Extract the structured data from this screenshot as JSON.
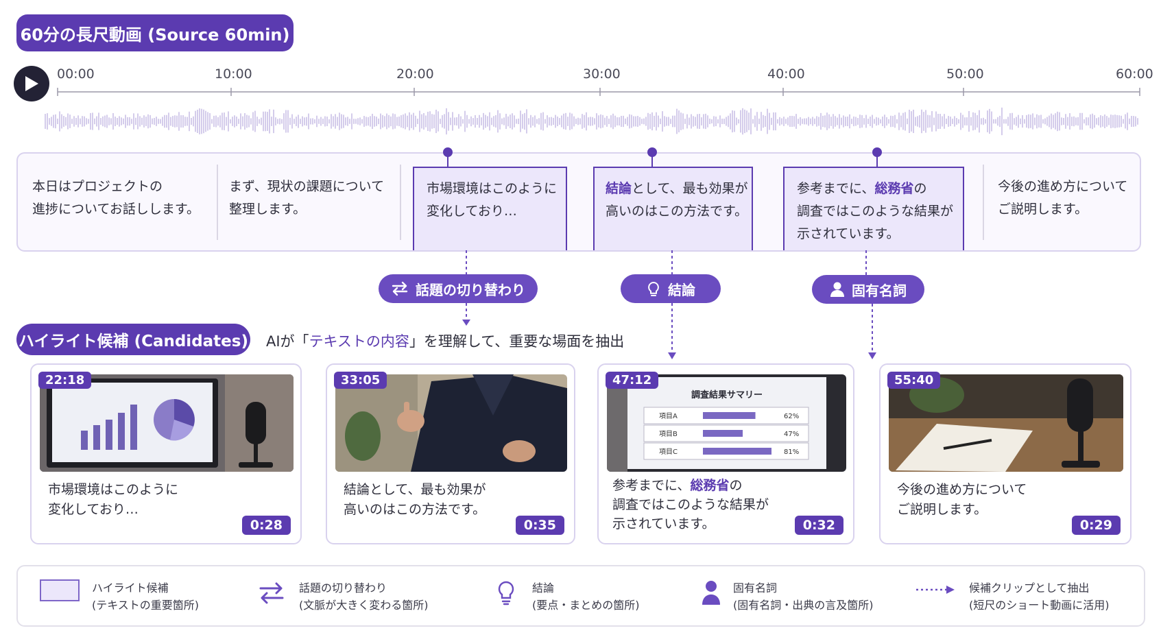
{
  "source_title": "60分の長尺動画 (Source 60min)",
  "timeline": {
    "ticks": [
      "00:00",
      "10:00",
      "20:00",
      "30:00",
      "40:00",
      "50:00",
      "60:00"
    ]
  },
  "transcript": {
    "segments": [
      {
        "line1": "本日はプロジェクトの",
        "line2": "進捗についてお話しします。",
        "line3": ""
      },
      {
        "line1": "まず、現状の課題について",
        "line2": "整理します。",
        "line3": ""
      },
      {
        "line1": "市場環境はこのように",
        "line2": "変化しており…",
        "line3": ""
      },
      {
        "line1_accent": "結論",
        "line1_rest": "として、最も効果が",
        "line2": "高いのはこの方法です。",
        "line3": ""
      },
      {
        "line1_pre": "参考までに、",
        "line1_accent": "総務省",
        "line1_post": "の",
        "line2": "調査ではこのような結果が",
        "line3": "示されています。"
      },
      {
        "line1": "今後の進め方について",
        "line2": "ご説明します。",
        "line3": ""
      }
    ]
  },
  "tags": {
    "topic_shift": "話題の切り替わり",
    "conclusion": "結論",
    "proper_noun": "固有名詞"
  },
  "candidates": {
    "title": "ハイライト候補 (Candidates)",
    "desc_pre": "AIが「",
    "desc_accent": "テキストの内容",
    "desc_post": "」を理解して、重要な場面を抽出",
    "cards": [
      {
        "start": "22:18",
        "line1": "市場環境はこのように",
        "line2": "変化しており…",
        "line3": "",
        "duration": "0:28"
      },
      {
        "start": "33:05",
        "line1": "結論として、最も効果が",
        "line2": "高いのはこの方法です。",
        "line3": "",
        "duration": "0:35"
      },
      {
        "start": "47:12",
        "line1_pre": "参考までに、",
        "line1_accent": "総務省",
        "line1_post": "の",
        "line2": "調査ではこのような結果が",
        "line3": "示されています。",
        "duration": "0:32"
      },
      {
        "start": "55:40",
        "line1": "今後の進め方について",
        "line2": "ご説明します。",
        "line3": "",
        "duration": "0:29"
      }
    ],
    "survey_slide": {
      "title": "調査結果サマリー",
      "rows": [
        {
          "label": "項目A",
          "value": "62%",
          "fraction": 0.62
        },
        {
          "label": "項目B",
          "value": "47%",
          "fraction": 0.47
        },
        {
          "label": "項目C",
          "value": "81%",
          "fraction": 0.81
        }
      ]
    }
  },
  "legend": {
    "items": [
      {
        "title": "ハイライト候補",
        "sub": "(テキストの重要箇所)",
        "icon": "highlight-box-icon"
      },
      {
        "title": "話題の切り替わり",
        "sub": "(文脈が大きく変わる箇所)",
        "icon": "swap-arrows-icon"
      },
      {
        "title": "結論",
        "sub": "(要点・まとめの箇所)",
        "icon": "lightbulb-icon"
      },
      {
        "title": "固有名詞",
        "sub": "(固有名詞・出典の言及箇所)",
        "icon": "person-icon"
      },
      {
        "title": "候補クリップとして抽出",
        "sub": "(短尺のショート動画に活用)",
        "icon": "dotted-arrow-icon"
      }
    ]
  },
  "colors": {
    "accent": "#5b3bb0",
    "tag": "#6a4cc0",
    "highlight_fill": "#ece7fb",
    "waveform": "#c9bfe6"
  }
}
